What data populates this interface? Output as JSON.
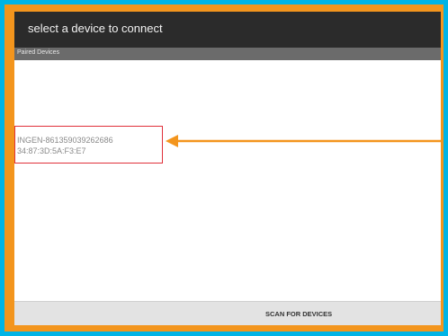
{
  "titlebar": {
    "title": "select a device to connect"
  },
  "paired_section": {
    "label": "Paired Devices"
  },
  "devices": [
    {
      "name": "INGEN-861359039262686",
      "address": "34:87:3D:5A:F3:E7"
    }
  ],
  "scan_button": {
    "label": "SCAN FOR DEVICES"
  },
  "colors": {
    "frame": "#f3951d",
    "background": "#00b4e6",
    "highlight_box": "#e0303a",
    "titlebar": "#2b2b2b"
  }
}
